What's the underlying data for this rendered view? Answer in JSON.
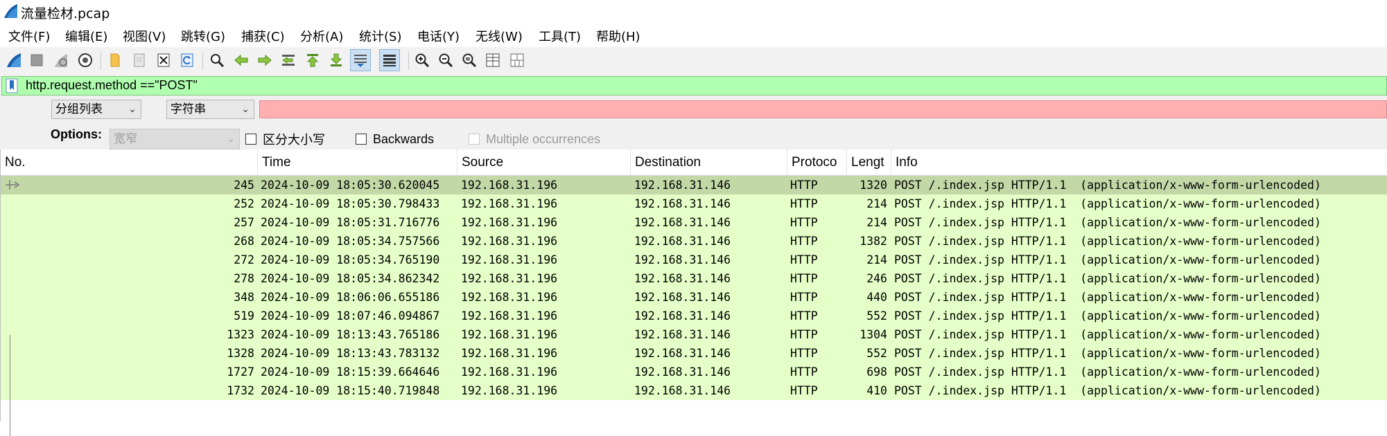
{
  "window": {
    "title": "流量检材.pcap"
  },
  "menu": [
    "文件(F)",
    "编辑(E)",
    "视图(V)",
    "跳转(G)",
    "捕获(C)",
    "分析(A)",
    "统计(S)",
    "电话(Y)",
    "无线(W)",
    "工具(T)",
    "帮助(H)"
  ],
  "toolbar": {
    "icons": [
      "shark-fin-start-icon",
      "stop-icon",
      "restart-icon",
      "capture-options-icon",
      "open-file-icon",
      "save-file-icon",
      "close-file-icon",
      "reload-icon",
      "find-packet-icon",
      "go-back-icon",
      "go-forward-icon",
      "go-to-packet-icon",
      "go-first-icon",
      "go-last-icon",
      "autoscroll-icon",
      "colorize-icon",
      "zoom-in-icon",
      "zoom-out-icon",
      "zoom-normal-icon",
      "resize-columns-icon",
      "layout-icon"
    ]
  },
  "filter": {
    "text": "http.request.method ==\"POST\"",
    "bg_color": "#afffaf"
  },
  "find": {
    "scope": "分组列表",
    "type": "字符串",
    "search_value": "",
    "search_bg_color": "#ffafaf"
  },
  "options": {
    "label": "Options:",
    "charset": "宽窄",
    "case_sensitive": "区分大小写",
    "backwards": "Backwards",
    "multiple": "Multiple occurrences"
  },
  "columns": [
    "No.",
    "Time",
    "Source",
    "Destination",
    "Protoco",
    "Lengt",
    "Info"
  ],
  "row_colors": {
    "normal": "#e4ffc7",
    "selected": "#c2d9a7"
  },
  "packets": [
    {
      "no": "245",
      "time": "2024-10-09 18:05:30.620045",
      "src": "192.168.31.196",
      "dst": "192.168.31.146",
      "proto": "HTTP",
      "len": "1320",
      "info": "POST /.index.jsp HTTP/1.1  (application/x-www-form-urlencoded)",
      "selected": true
    },
    {
      "no": "252",
      "time": "2024-10-09 18:05:30.798433",
      "src": "192.168.31.196",
      "dst": "192.168.31.146",
      "proto": "HTTP",
      "len": "214",
      "info": "POST /.index.jsp HTTP/1.1  (application/x-www-form-urlencoded)"
    },
    {
      "no": "257",
      "time": "2024-10-09 18:05:31.716776",
      "src": "192.168.31.196",
      "dst": "192.168.31.146",
      "proto": "HTTP",
      "len": "214",
      "info": "POST /.index.jsp HTTP/1.1  (application/x-www-form-urlencoded)"
    },
    {
      "no": "268",
      "time": "2024-10-09 18:05:34.757566",
      "src": "192.168.31.196",
      "dst": "192.168.31.146",
      "proto": "HTTP",
      "len": "1382",
      "info": "POST /.index.jsp HTTP/1.1  (application/x-www-form-urlencoded)"
    },
    {
      "no": "272",
      "time": "2024-10-09 18:05:34.765190",
      "src": "192.168.31.196",
      "dst": "192.168.31.146",
      "proto": "HTTP",
      "len": "214",
      "info": "POST /.index.jsp HTTP/1.1  (application/x-www-form-urlencoded)"
    },
    {
      "no": "278",
      "time": "2024-10-09 18:05:34.862342",
      "src": "192.168.31.196",
      "dst": "192.168.31.146",
      "proto": "HTTP",
      "len": "246",
      "info": "POST /.index.jsp HTTP/1.1  (application/x-www-form-urlencoded)"
    },
    {
      "no": "348",
      "time": "2024-10-09 18:06:06.655186",
      "src": "192.168.31.196",
      "dst": "192.168.31.146",
      "proto": "HTTP",
      "len": "440",
      "info": "POST /.index.jsp HTTP/1.1  (application/x-www-form-urlencoded)"
    },
    {
      "no": "519",
      "time": "2024-10-09 18:07:46.094867",
      "src": "192.168.31.196",
      "dst": "192.168.31.146",
      "proto": "HTTP",
      "len": "552",
      "info": "POST /.index.jsp HTTP/1.1  (application/x-www-form-urlencoded)"
    },
    {
      "no": "1323",
      "time": "2024-10-09 18:13:43.765186",
      "src": "192.168.31.196",
      "dst": "192.168.31.146",
      "proto": "HTTP",
      "len": "1304",
      "info": "POST /.index.jsp HTTP/1.1  (application/x-www-form-urlencoded)"
    },
    {
      "no": "1328",
      "time": "2024-10-09 18:13:43.783132",
      "src": "192.168.31.196",
      "dst": "192.168.31.146",
      "proto": "HTTP",
      "len": "552",
      "info": "POST /.index.jsp HTTP/1.1  (application/x-www-form-urlencoded)"
    },
    {
      "no": "1727",
      "time": "2024-10-09 18:15:39.664646",
      "src": "192.168.31.196",
      "dst": "192.168.31.146",
      "proto": "HTTP",
      "len": "698",
      "info": "POST /.index.jsp HTTP/1.1  (application/x-www-form-urlencoded)"
    },
    {
      "no": "1732",
      "time": "2024-10-09 18:15:40.719848",
      "src": "192.168.31.196",
      "dst": "192.168.31.146",
      "proto": "HTTP",
      "len": "410",
      "info": "POST /.index.jsp HTTP/1.1  (application/x-www-form-urlencoded)"
    }
  ]
}
